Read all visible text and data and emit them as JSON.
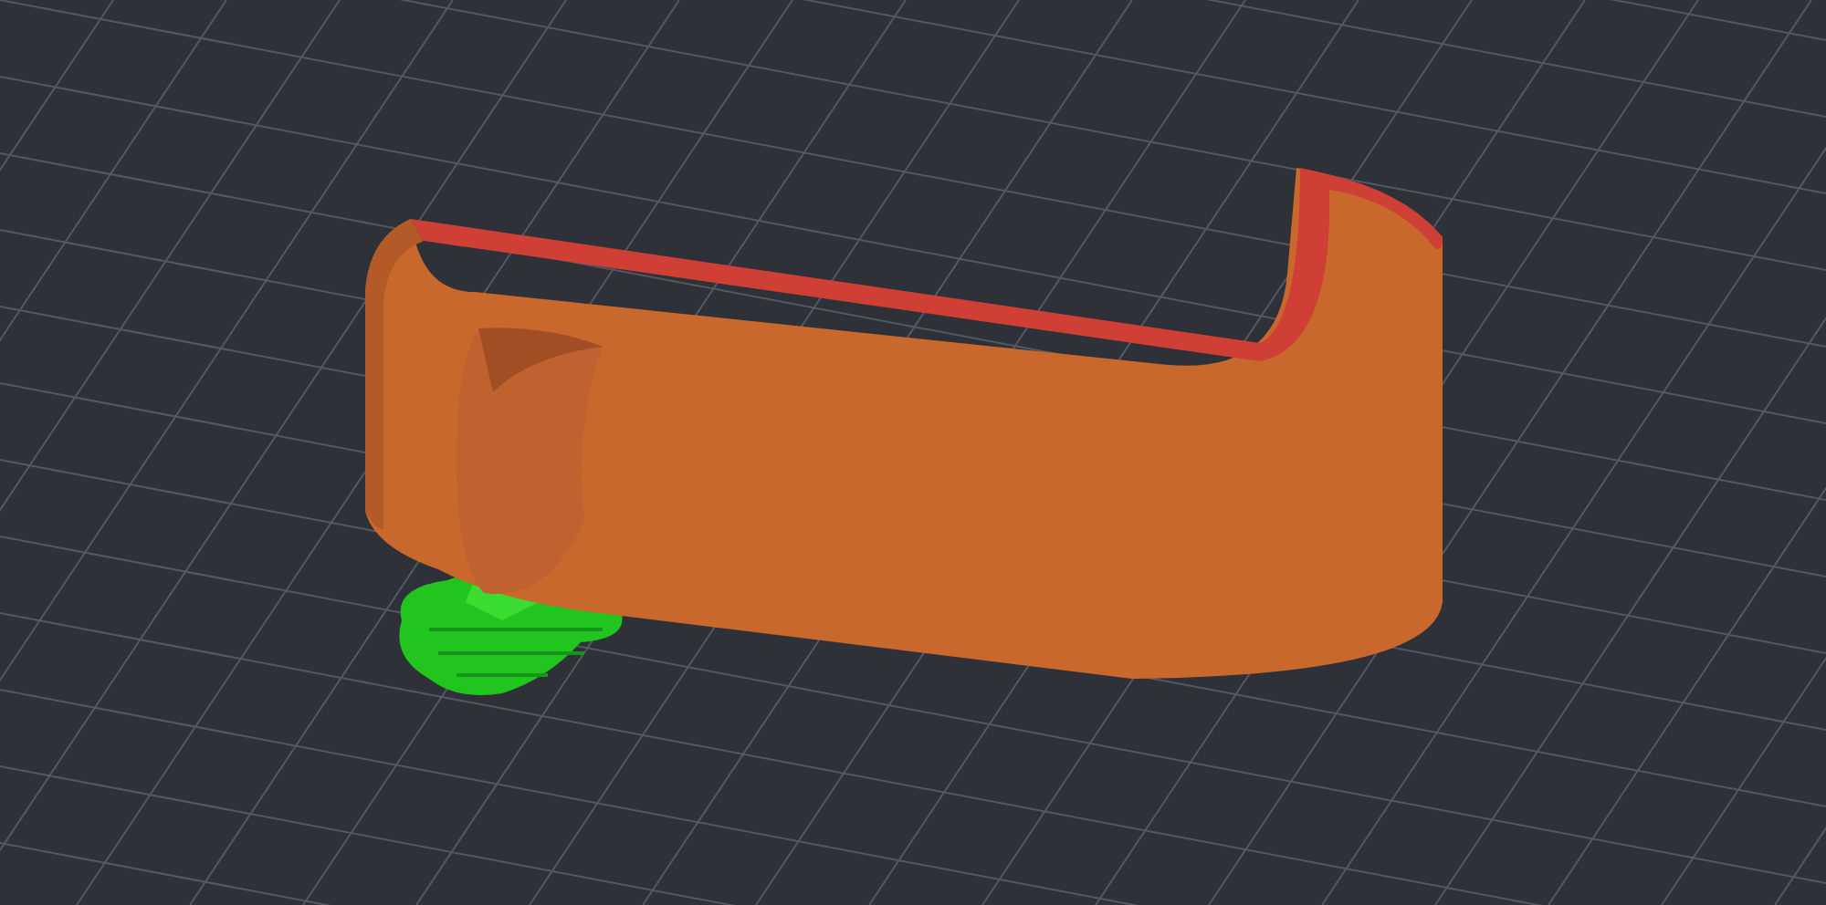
{
  "viewport": {
    "show_grid": true,
    "show_supports": true
  }
}
